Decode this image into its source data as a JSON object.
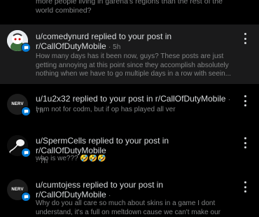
{
  "top_fragment": "more people living in garena's regions than the rest of the world combined?",
  "notifications": [
    {
      "title": "u/comedynurd replied to your post in r/CallOfDutyMobile",
      "age": "· 5h",
      "body": "How many days has it been now, guys? These posts are just getting annoying at this point since they accomplish absolutely nothing when we have to go multiple days in a row with seein...",
      "avatar_icon": "snoo-avatar-icon",
      "unread": true
    },
    {
      "title": "u/1u2x32 replied to your post in r/CallOfDutyMobile",
      "age": "· 7h",
      "body": "I am not for codm, but if op has played all ver",
      "avatar_icon": "nerv-avatar-icon",
      "avatar_text": "NERV",
      "unread": false
    },
    {
      "title": "u/SpermCells replied to your post in r/CallOfDutyMobile",
      "age": "· 7h",
      "body": "who is we??? 🤣🤣🤣",
      "avatar_icon": "sperm-avatar-icon",
      "unread": false
    },
    {
      "title": "u/cumtojess replied to your post in r/CallOfDutyMobile",
      "age": "·",
      "body": "Why do you all care so much about skins in a game I dont understand, it's a full on meltdown cause we can't make our",
      "avatar_icon": "nerv-avatar-icon",
      "avatar_text": "NERV",
      "unread": false
    }
  ],
  "colors": {
    "unread_bg": "#1a1a1b",
    "badge": "#0079d3",
    "muted_text": "#818384"
  }
}
